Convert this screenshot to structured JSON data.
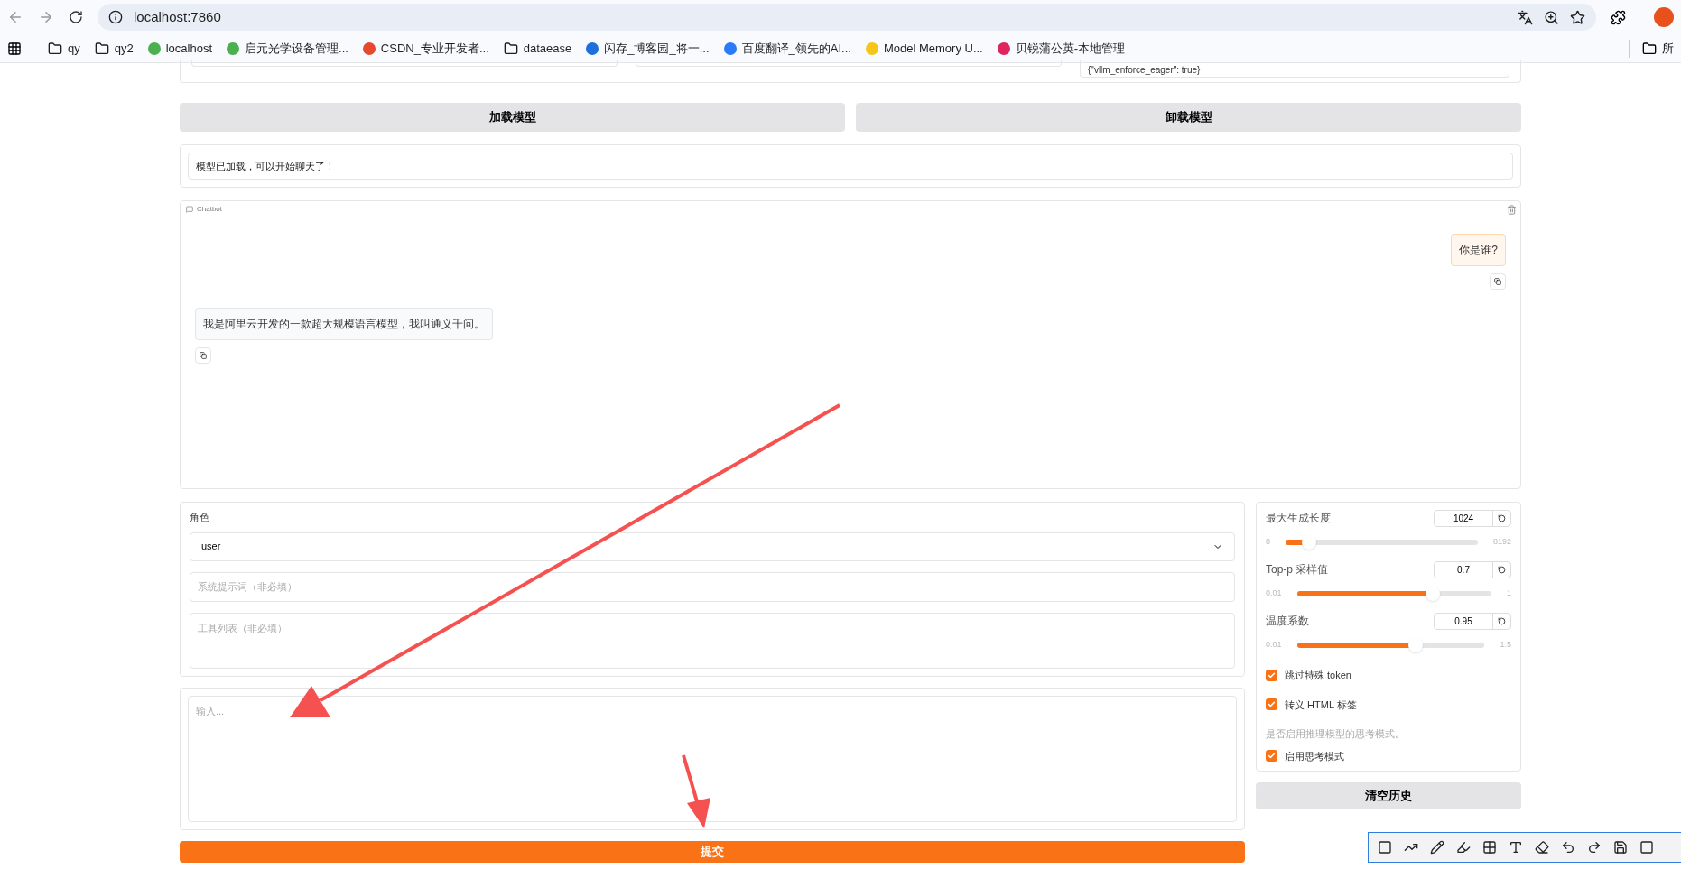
{
  "browser": {
    "url": "localhost:7860",
    "bookmarks": [
      {
        "kind": "folder",
        "label": "qy"
      },
      {
        "kind": "folder",
        "label": "qy2"
      },
      {
        "kind": "site",
        "label": "localhost",
        "color": "#4caf50"
      },
      {
        "kind": "site",
        "label": "启元光学设备管理...",
        "color": "#4caf50"
      },
      {
        "kind": "site",
        "label": "CSDN_专业开发者...",
        "color": "#e8492c"
      },
      {
        "kind": "folder",
        "label": "dataease"
      },
      {
        "kind": "site",
        "label": "闪存_博客园_将一...",
        "color": "#1e6fd9"
      },
      {
        "kind": "site",
        "label": "百度翻译_领先的AI...",
        "color": "#2a7cf6"
      },
      {
        "kind": "site",
        "label": "Model Memory U...",
        "color": "#f5c518"
      },
      {
        "kind": "site",
        "label": "贝锐蒲公英-本地管理",
        "color": "#e0245e"
      }
    ],
    "bookmarks_right": "所"
  },
  "config_field_value": "{\"vllm_enforce_eager\": true}",
  "buttons": [
    "加载模型",
    "卸载模型"
  ],
  "status": "模型已加载，可以开始聊天了！",
  "chatbot": {
    "label": "Chatbot",
    "messages": [
      {
        "kind": "user",
        "text": "你是谁?"
      },
      {
        "kind": "assistant",
        "text": "我是阿里云开发的一款超大规模语言模型，我叫通义千问。"
      }
    ]
  },
  "role": {
    "label": "角色",
    "value": "user"
  },
  "system_prompt": {
    "placeholder": "系统提示词（非必填）"
  },
  "tools": {
    "placeholder": "工具列表（非必填）"
  },
  "input": {
    "placeholder": "输入..."
  },
  "submit": "提交",
  "sliders": [
    {
      "label": "最大生成长度",
      "value": "1024",
      "min": "8",
      "max": "8192",
      "level": 0.124
    },
    {
      "label": "Top-p 采样值",
      "value": "0.7",
      "min": "0.01",
      "max": "1",
      "level": 0.697
    },
    {
      "label": "温度系数",
      "value": "0.95",
      "min": "0.01",
      "max": "1.5",
      "level": 0.631
    }
  ],
  "checkboxes": [
    {
      "label": "跳过特殊 token",
      "checked": true
    },
    {
      "label": "转义 HTML 标签",
      "checked": true
    },
    {
      "info": "是否启用推理模型的思考模式。",
      "label": "启用思考模式",
      "checked": true
    }
  ],
  "clear_history": "清空历史"
}
